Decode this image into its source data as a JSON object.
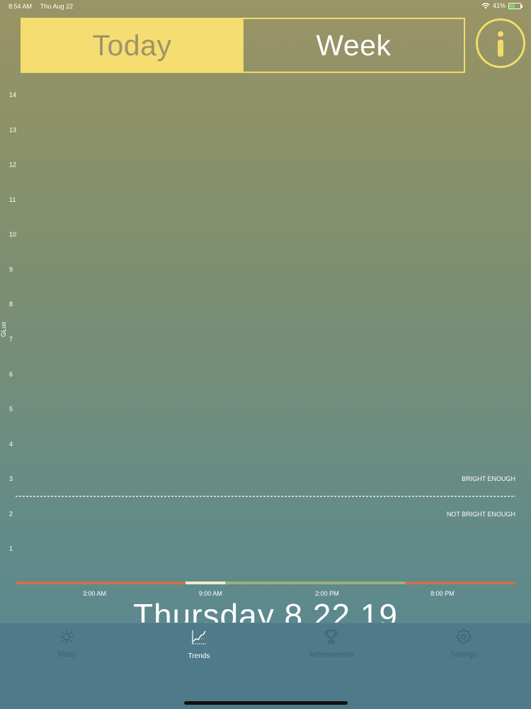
{
  "status_bar": {
    "time": "8:54 AM",
    "date": "Thu Aug 22",
    "battery": "41%",
    "battery_level": 0.41
  },
  "segmented": {
    "today": "Today",
    "week": "Week",
    "selected": "today"
  },
  "info_button": {
    "glyph": "i"
  },
  "chart_data": {
    "type": "line",
    "ylabel": "GLux",
    "ylim": [
      0,
      14
    ],
    "y_ticks": [
      "1",
      "2",
      "3",
      "4",
      "5",
      "6",
      "7",
      "8",
      "9",
      "10",
      "11",
      "12",
      "13",
      "14"
    ],
    "x_tick_labels": [
      "3:00 AM",
      "9:00 AM",
      "2:00 PM",
      "8:00 PM"
    ],
    "threshold": {
      "value": 2.5,
      "above_label": "BRIGHT ENOUGH",
      "below_label": "NOT BRIGHT ENOUGH"
    },
    "series": [],
    "timeline_bar": [
      {
        "start": 0.0,
        "end": 0.34,
        "color": "#c8734f"
      },
      {
        "start": 0.34,
        "end": 0.42,
        "color": "#f1ead0"
      },
      {
        "start": 0.42,
        "end": 0.78,
        "color": "#9cb07a"
      },
      {
        "start": 0.78,
        "end": 1.0,
        "color": "#c8734f"
      }
    ],
    "grid": false
  },
  "date_title": "Thursday 8.22.19",
  "tab_bar": {
    "items": [
      {
        "label": "Today",
        "icon": "sun-icon"
      },
      {
        "label": "Trends",
        "icon": "trend-chart-icon"
      },
      {
        "label": "Achievements",
        "icon": "trophy-icon"
      },
      {
        "label": "Settings",
        "icon": "gear-icon"
      }
    ],
    "selected": "Trends"
  },
  "colors": {
    "accent": "#f5dd72",
    "tab_bg": "#4f7a89"
  }
}
